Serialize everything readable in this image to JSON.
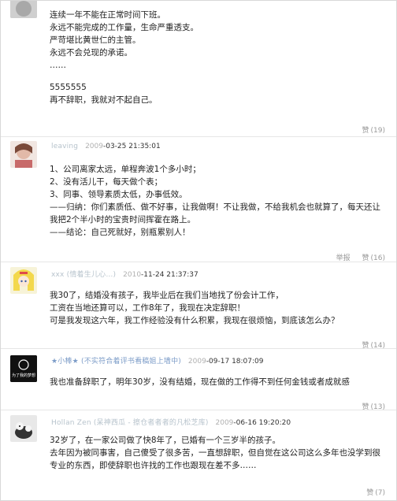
{
  "comments": [
    {
      "lines": [
        "连续一年不能在正常时间下班。",
        "永远不能完成的工作量，生命严重透支。",
        "严苛堪比黄世仁的主管。",
        "永远不会兑现的承诺。",
        "……",
        "",
        "5555555",
        "再不辞职，我就对不起自己。"
      ],
      "like_label": "赞",
      "like_count": "(19)"
    },
    {
      "user": "leaving",
      "time_prefix": "2009",
      "time": "-03-25 21:35:01",
      "lines": [
        "1、公司离家太远，单程奔波1个多小时；",
        "2、没有活儿干，每天做个表；",
        "3、同事、领导素质太低，办事低效。",
        "——归纳：你们素质低、做不好事，让我做啊！不让我做，不给我机会也就算了，每天还让我把2个半小时的宝贵时间挥霍在路上。",
        "——结论：自己死就好，别瓶累别人！"
      ],
      "report_label": "举报",
      "like_label": "赞",
      "like_count": "(16)"
    },
    {
      "user": "xxx (情着生儿心…)",
      "time_prefix": "2010",
      "time": "-11-24 21:37:37",
      "lines": [
        "我30了，结婚没有孩子，我毕业后在我们当地找了份会计工作，",
        "工资在当地还算可以，工作8年了，我现在决定辞职！",
        "可是我发现这六年，我工作经验没有什么积累，我现在很烦恼，到底该怎么办？"
      ],
      "like_label": "赞",
      "like_count": "(14)"
    },
    {
      "user": "★小棒★ (不实符合着评书看稿姐上墙中)",
      "time_prefix": "2009",
      "time": "-09-17 18:07:09",
      "avatar_text": "为了我的梦想",
      "lines": [
        "我也准备辞职了，明年30岁，没有结婚，现在做的工作得不到任何金钱或者成就感"
      ],
      "like_label": "赞",
      "like_count": "(13)"
    },
    {
      "user": "Hollan Zen (呆神西瓜 - 擦仓者者者的凡松芝库)",
      "time_prefix": "2009",
      "time": "-06-16 19:20:20",
      "lines": [
        "32岁了，在一家公司做了快8年了，已婚有一个三岁半的孩子。",
        "去年因为被同事害，自己傻受了很多苦，一直想辞职，但自觉在这公司这么多年也没学到很专业的东西，即使辞职也许找的工作也跟现在差不多……"
      ],
      "like_label": "赞",
      "like_count": "(7)"
    }
  ],
  "colors": {
    "text": "#222222",
    "meta": "#9aa5b0",
    "divider": "#e6e6e6",
    "action": "#999999"
  }
}
